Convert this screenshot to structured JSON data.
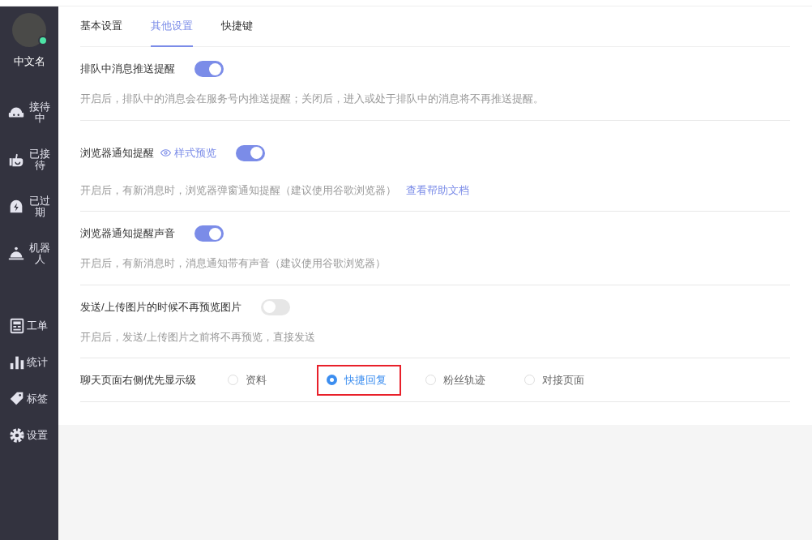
{
  "user": {
    "name": "中文名",
    "online": true
  },
  "sidebar": {
    "items": [
      {
        "label": "接待中",
        "kind": "stacked"
      },
      {
        "label": "已接待",
        "kind": "stacked"
      },
      {
        "label": "已过期",
        "kind": "stacked"
      },
      {
        "label": "机器人",
        "kind": "stacked"
      },
      {
        "label": "工单",
        "kind": "inline"
      },
      {
        "label": "统计",
        "kind": "inline"
      },
      {
        "label": "标签",
        "kind": "inline"
      },
      {
        "label": "设置",
        "kind": "inline"
      }
    ]
  },
  "tabs": [
    {
      "label": "基本设置",
      "selected": false
    },
    {
      "label": "其他设置",
      "selected": true
    },
    {
      "label": "快捷键",
      "selected": false
    }
  ],
  "settings": [
    {
      "kind": "toggle",
      "title": "排队中消息推送提醒",
      "on": true,
      "description": "开启后，排队中的消息会在服务号内推送提醒；关闭后，进入或处于排队中的消息将不再推送提醒。"
    },
    {
      "kind": "toggle",
      "title": "浏览器通知提醒",
      "preview_link": "样式预览",
      "on": true,
      "description": "开启后，有新消息时，浏览器弹窗通知提醒（建议使用谷歌浏览器）",
      "help_link": "查看帮助文档"
    },
    {
      "kind": "toggle",
      "title": "浏览器通知提醒声音",
      "on": true,
      "description": "开启后，有新消息时，消息通知带有声音（建议使用谷歌浏览器）"
    },
    {
      "kind": "toggle",
      "title": "发送/上传图片的时候不再预览图片",
      "on": false,
      "description": "开启后，发送/上传图片之前将不再预览，直接发送"
    },
    {
      "kind": "radio",
      "title": "聊天页面右侧优先显示级",
      "options": [
        {
          "label": "资料",
          "selected": false,
          "highlighted": false
        },
        {
          "label": "快捷回复",
          "selected": true,
          "highlighted": true
        },
        {
          "label": "粉丝轨迹",
          "selected": false,
          "highlighted": false
        },
        {
          "label": "对接页面",
          "selected": false,
          "highlighted": false
        }
      ]
    }
  ]
}
